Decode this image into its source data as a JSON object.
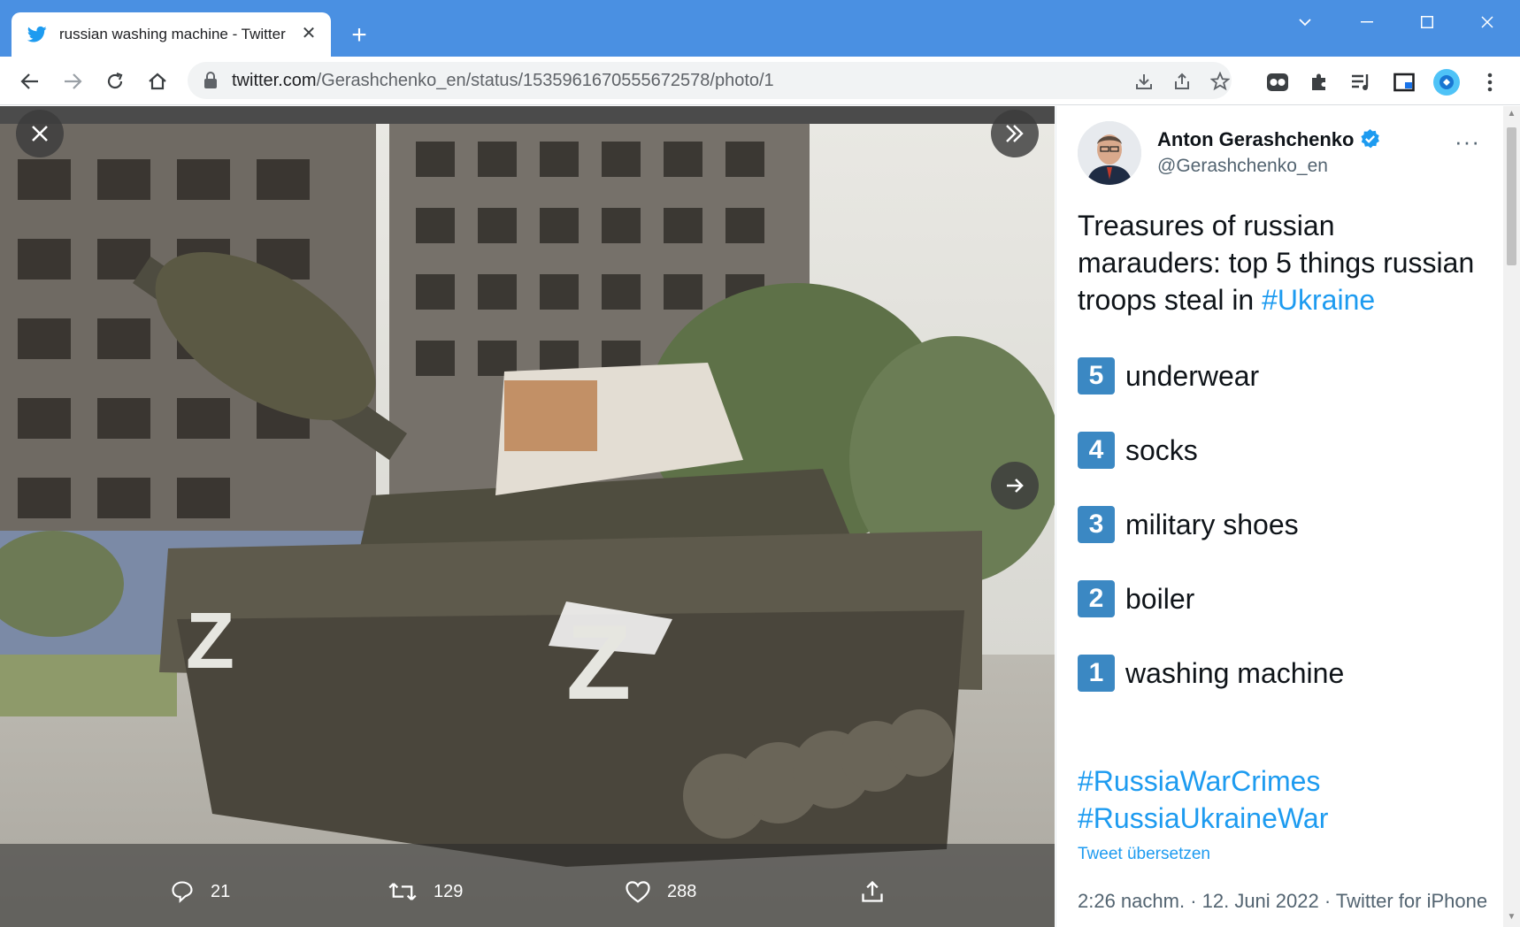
{
  "browser": {
    "tab_title": "russian washing machine - Twitter",
    "new_tab_label": "+",
    "url_host": "twitter.com",
    "url_path": "/Gerashchenko_en/status/1535961670555672578/photo/1"
  },
  "viewer": {
    "photo_alt": "Tank with Z marking carrying looted goods in front of destroyed apartment buildings",
    "z_marking": "Z",
    "actions": {
      "replies": "21",
      "retweets": "129",
      "likes": "288"
    }
  },
  "tweet": {
    "author_name": "Anton Gerashchenko",
    "handle": "@Gerashchenko_en",
    "more_label": "···",
    "text_intro": "Treasures of russian marauders: top 5 things russian troops steal in ",
    "text_hashtag": "#Ukraine",
    "items": [
      {
        "rank": "5",
        "label": "underwear"
      },
      {
        "rank": "4",
        "label": "socks"
      },
      {
        "rank": "3",
        "label": "military shoes"
      },
      {
        "rank": "2",
        "label": "boiler"
      },
      {
        "rank": "1",
        "label": "washing machine"
      }
    ],
    "hashtag_1": "#RussiaWarCrimes",
    "hashtag_2": "#RussiaUkraineWar",
    "translate_label": "Tweet übersetzen",
    "timestamp": "2:26 nachm. · 12. Juni 2022 · Twitter for iPhone"
  },
  "colors": {
    "chrome_blue": "#4a90e2",
    "twitter_blue": "#1d9bf0",
    "keycap_blue": "#3b88c3"
  }
}
